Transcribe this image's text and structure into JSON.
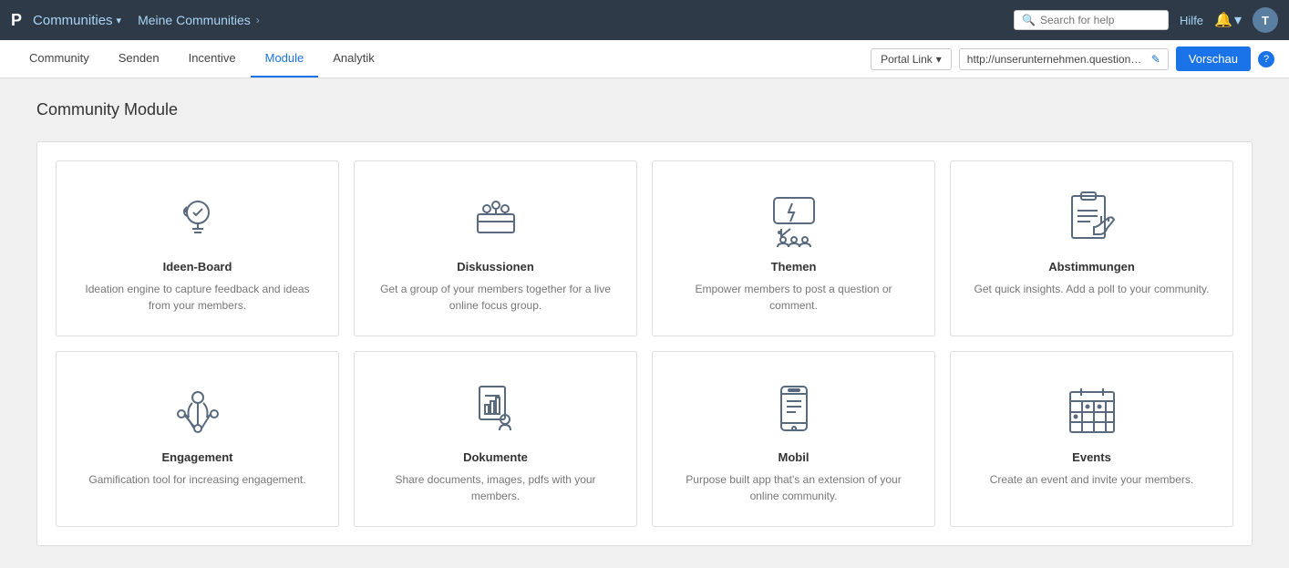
{
  "topbar": {
    "logo": "P",
    "app_name": "Communities",
    "breadcrumb_label": "Meine Communities",
    "breadcrumb_arrow": "›",
    "search_placeholder": "Search for help",
    "help_label": "Hilfe",
    "avatar_label": "T"
  },
  "subnav": {
    "items": [
      {
        "id": "community",
        "label": "Community",
        "active": false
      },
      {
        "id": "senden",
        "label": "Senden",
        "active": false
      },
      {
        "id": "incentive",
        "label": "Incentive",
        "active": false
      },
      {
        "id": "module",
        "label": "Module",
        "active": true
      },
      {
        "id": "analytik",
        "label": "Analytik",
        "active": false
      }
    ],
    "portal_link_label": "Portal Link",
    "portal_url": "http://unserunternehmen.questionpro.e",
    "preview_label": "Vorschau"
  },
  "page": {
    "title": "Community Module"
  },
  "modules": {
    "row1": [
      {
        "id": "ideen-board",
        "name": "Ideen-Board",
        "description": "Ideation engine to capture feedback and ideas from your members."
      },
      {
        "id": "diskussionen",
        "name": "Diskussionen",
        "description": "Get a group of your members together for a live online focus group."
      },
      {
        "id": "themen",
        "name": "Themen",
        "description": "Empower members to post a question or comment."
      },
      {
        "id": "abstimmungen",
        "name": "Abstimmungen",
        "description": "Get quick insights. Add a poll to your community."
      }
    ],
    "row2": [
      {
        "id": "engagement",
        "name": "Engagement",
        "description": "Gamification tool for increasing engagement."
      },
      {
        "id": "dokumente",
        "name": "Dokumente",
        "description": "Share documents, images, pdfs with your members."
      },
      {
        "id": "mobil",
        "name": "Mobil",
        "description": "Purpose built app that's an extension of your online community."
      },
      {
        "id": "events",
        "name": "Events",
        "description": "Create an event and invite your members."
      }
    ]
  }
}
